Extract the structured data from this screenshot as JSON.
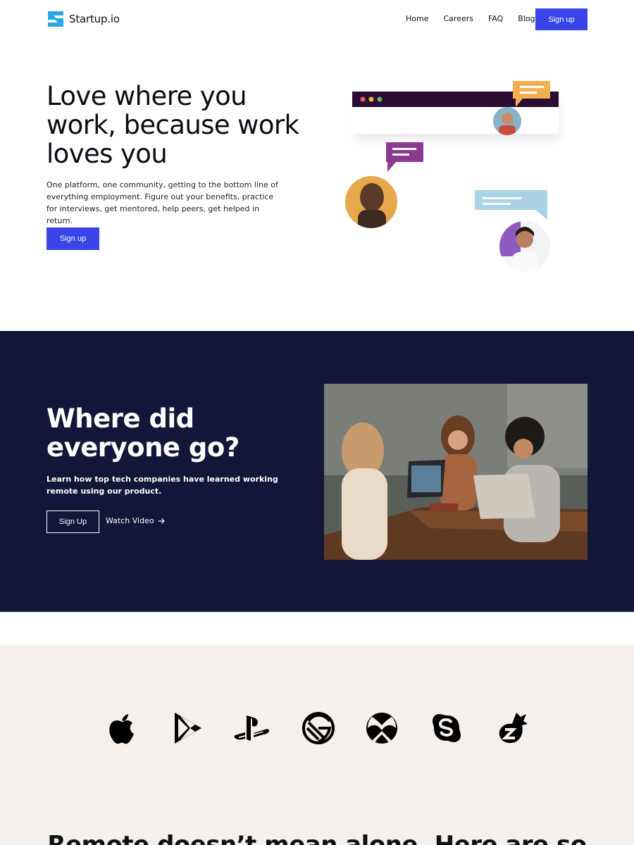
{
  "brand": {
    "name": "Startup.io",
    "accent": "#3a44e8",
    "logo_color": "#2aa7e6"
  },
  "nav": {
    "links": [
      "Home",
      "Careers",
      "FAQ",
      "Blog"
    ],
    "signup_label": "Sign up"
  },
  "hero": {
    "title": "Love where you work, because work loves you",
    "text": "One platform, one community, getting to the bottom line of everything employment. Figure out your benefits, practice for interviews, get mentored, help peers, get helped in return.",
    "signup_label": "Sign up"
  },
  "remote": {
    "title": "Where did everyone go?",
    "text": "Learn how top tech companies have learned working remote using our product.",
    "signup_label": "Sign Up",
    "watch_label": "Watch Video",
    "background": "#121739"
  },
  "partners": {
    "icons": [
      "apple-icon",
      "google-play-icon",
      "playstation-icon",
      "gatsby-icon",
      "xbox-icon",
      "skype-icon",
      "zendesk-icon"
    ],
    "background": "#f5f0eb"
  },
  "bottom": {
    "title": "Remote doesn’t mean alone. Here are so"
  }
}
